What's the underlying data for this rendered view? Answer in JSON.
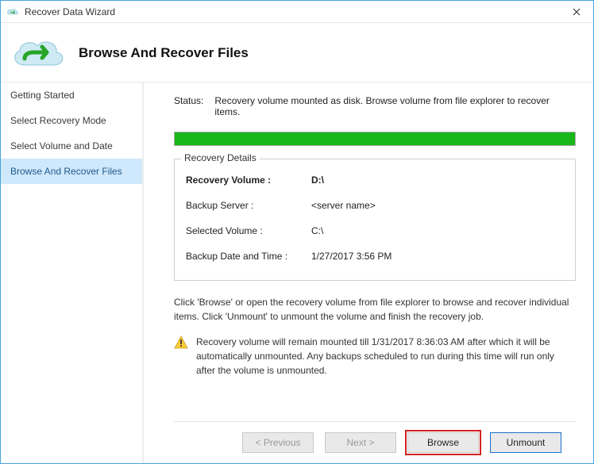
{
  "window": {
    "title": "Recover Data Wizard"
  },
  "header": {
    "title": "Browse And Recover Files"
  },
  "sidebar": {
    "items": [
      {
        "label": "Getting Started"
      },
      {
        "label": "Select Recovery Mode"
      },
      {
        "label": "Select Volume and Date"
      },
      {
        "label": "Browse And Recover Files"
      }
    ],
    "activeIndex": 3
  },
  "status": {
    "label": "Status:",
    "text": "Recovery volume mounted as disk. Browse volume from file explorer to recover items."
  },
  "details": {
    "legend": "Recovery Details",
    "rows": [
      {
        "k": "Recovery Volume :",
        "v": "D:\\"
      },
      {
        "k": "Backup Server :",
        "v": "<server name>"
      },
      {
        "k": "Selected Volume :",
        "v": "C:\\"
      },
      {
        "k": "Backup Date and Time :",
        "v": "1/27/2017 3:56 PM"
      }
    ]
  },
  "hint": "Click 'Browse' or open the recovery volume from file explorer to browse and recover individual items. Click 'Unmount' to unmount the volume and finish the recovery job.",
  "warning": "Recovery volume will remain mounted till 1/31/2017 8:36:03 AM after which it will be automatically unmounted. Any backups scheduled to run during this time will run only after the volume is unmounted.",
  "buttons": {
    "prev": "< Previous",
    "next": "Next >",
    "browse": "Browse",
    "unmount": "Unmount"
  }
}
